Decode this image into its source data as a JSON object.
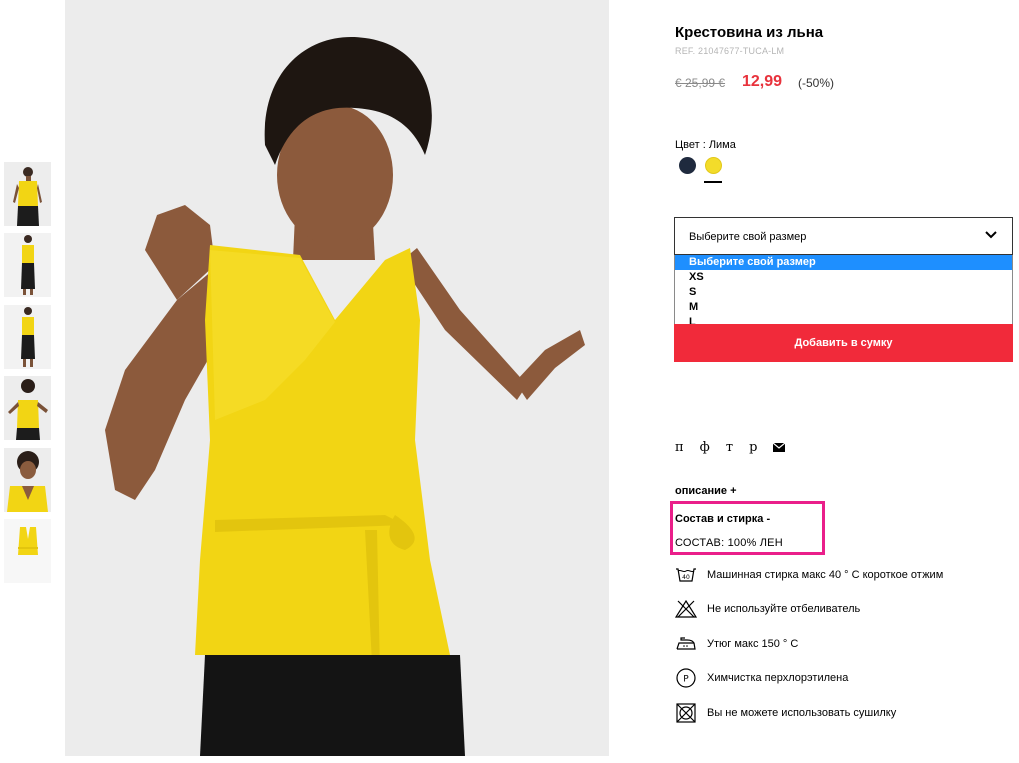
{
  "product": {
    "title": "Крестовина из льна",
    "ref": "REF. 21047677-TUCA-LM",
    "old_price": "€ 25,99 €",
    "new_price": "12,99",
    "discount": "(-50%)"
  },
  "colors": {
    "label": "Цвет : Лима",
    "options": [
      {
        "name": "navy",
        "hex": "#1f2a3e"
      },
      {
        "name": "lime",
        "hex": "#f3dc2a"
      }
    ],
    "selected": "lime"
  },
  "size_select": {
    "value": "Выберите свой размер",
    "options": [
      "Выберите свой размер",
      "XS",
      "S",
      "M",
      "L"
    ],
    "highlighted": 0
  },
  "add_to_bag": "Добавить в сумку",
  "share": {
    "icons": [
      "п",
      "ф",
      "т",
      "р"
    ],
    "email_icon": "envelope-icon"
  },
  "sections": {
    "description": "описание +",
    "composition": "Состав и стирка -",
    "composition_value": "СОСТАВ: 100% ЛЕН"
  },
  "care": [
    {
      "icon": "wash-40-icon",
      "text": "Машинная стирка макс 40 ° C короткое отжим"
    },
    {
      "icon": "no-bleach-icon",
      "text": "Не используйте отбеливатель"
    },
    {
      "icon": "iron-150-icon",
      "text": "Утюг макс 150 ° C"
    },
    {
      "icon": "dry-clean-p-icon",
      "text": "Химчистка перхлорэтилена"
    },
    {
      "icon": "no-tumble-dry-icon",
      "text": "Вы не можете использовать сушилку"
    }
  ],
  "accent_colors": {
    "price_red": "#e8323c",
    "button_red": "#f12a3a",
    "highlight_pink": "#ea1f8a",
    "dropdown_blue": "#1e8fff"
  }
}
